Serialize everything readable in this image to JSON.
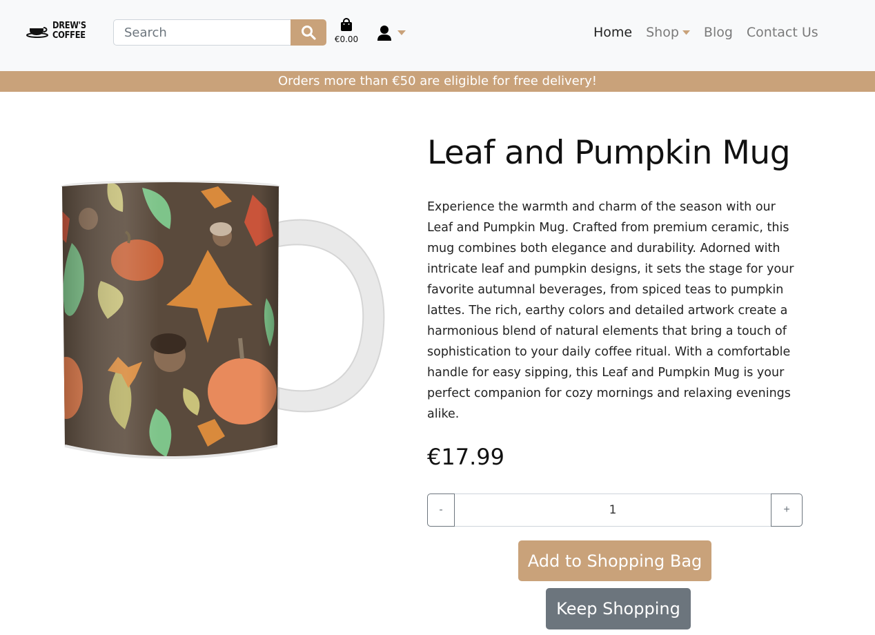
{
  "header": {
    "logo": {
      "line1": "DREW'S",
      "line2": "COFFEE"
    },
    "search": {
      "placeholder": "Search"
    },
    "bag": {
      "total": "€0.00"
    },
    "nav": {
      "home": "Home",
      "shop": "Shop",
      "blog": "Blog",
      "contact": "Contact Us"
    }
  },
  "banner": {
    "text": "Orders more than €50 are eligible for free delivery!"
  },
  "product": {
    "title": "Leaf and Pumpkin Mug",
    "description": "Experience the warmth and charm of the season with our Leaf and Pumpkin Mug. Crafted from premium ceramic, this mug combines both elegance and durability. Adorned with intricate leaf and pumpkin designs, it sets the stage for your favorite autumnal beverages, from spiced teas to pumpkin lattes. The rich, earthy colors and detailed artwork create a harmonious blend of natural elements that bring a touch of sophistication to your daily coffee ritual. With a comfortable handle for easy sipping, this Leaf and Pumpkin Mug is your perfect companion for cozy mornings and relaxing evenings alike.",
    "price": "€17.99",
    "quantity": {
      "minus": "-",
      "value": "1",
      "plus": "+"
    },
    "buttons": {
      "add": "Add to Shopping Bag",
      "keep": "Keep Shopping"
    }
  },
  "colors": {
    "accent": "#c9a27a",
    "navbar_bg": "#f8f9fa",
    "secondary": "#6c757d",
    "mug_body": "#5a4a3c"
  },
  "icons": {
    "logo": "coffee-cup-icon",
    "search": "search-icon",
    "bag": "shopping-bag-icon",
    "account": "user-icon",
    "dropdown": "caret-down-icon"
  }
}
